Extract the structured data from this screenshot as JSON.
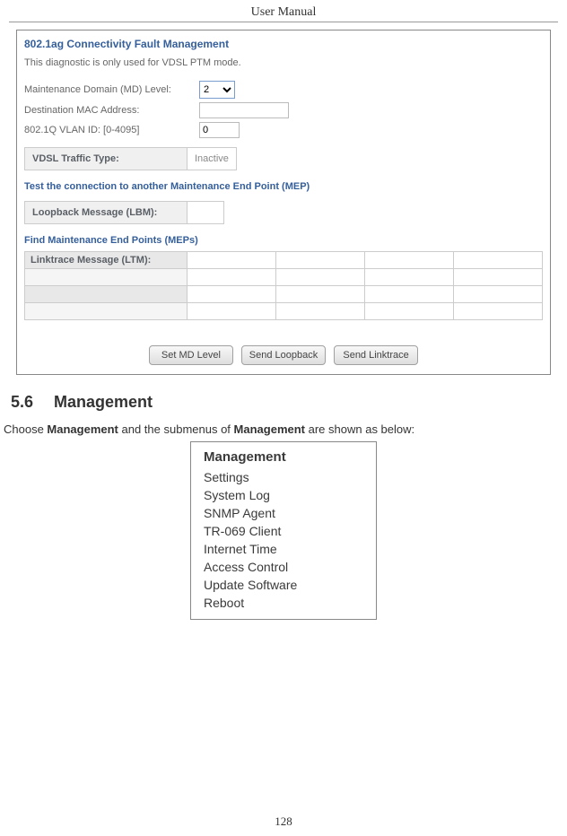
{
  "header": {
    "title": "User Manual"
  },
  "cfm": {
    "title": "802.1ag Connectivity Fault Management",
    "desc": "This diagnostic is only used for VDSL PTM mode.",
    "md_level_label": "Maintenance Domain (MD) Level:",
    "md_level_value": "2",
    "dest_mac_label": "Destination MAC Address:",
    "dest_mac_value": "",
    "vlan_label": "802.1Q VLAN ID: [0-4095]",
    "vlan_value": "0",
    "vdsl_label": "VDSL Traffic Type:",
    "vdsl_value": "Inactive",
    "test_heading": "Test the connection to another Maintenance End Point (MEP)",
    "lbm_label": "Loopback Message (LBM):",
    "lbm_value": "",
    "find_heading": "Find Maintenance End Points (MEPs)",
    "ltm_label": "Linktrace Message (LTM):",
    "buttons": {
      "set": "Set MD Level",
      "loopback": "Send Loopback",
      "linktrace": "Send Linktrace"
    }
  },
  "section": {
    "number": "5.6",
    "title": "Management",
    "body_pre": "Choose ",
    "body_bold1": "Management",
    "body_mid": " and the submenus of ",
    "body_bold2": "Management",
    "body_post": " are shown as below:"
  },
  "submenu": {
    "head": "Management",
    "items": [
      "Settings",
      "System Log",
      "SNMP Agent",
      "TR-069 Client",
      "Internet Time",
      "Access Control",
      "Update Software",
      "Reboot"
    ]
  },
  "page_number": "128"
}
